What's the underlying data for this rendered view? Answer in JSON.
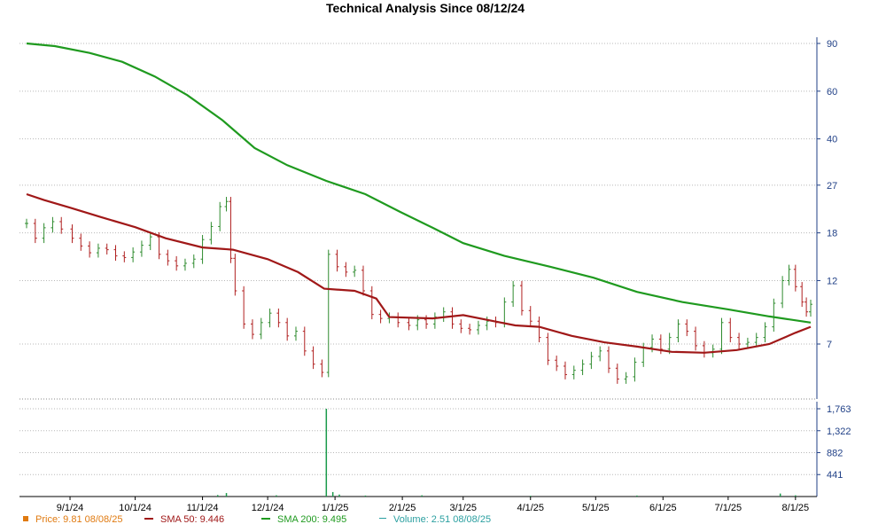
{
  "title": "Technical Analysis Since 08/12/24",
  "colors": {
    "price_up": "#2e8b2e",
    "price_down": "#b02020",
    "sma50": "#a01818",
    "sma200": "#1f9a1f",
    "volume": "#1a9a4a",
    "axis_text": "#1f3f86",
    "grid": "#b8b8b8",
    "legend_price": "#e07a10",
    "legend_sma50": "#a01818",
    "legend_sma200": "#1f9a1f",
    "legend_volume": "#2a9fa0"
  },
  "legend": {
    "price": "Price: 9.81  08/08/25",
    "sma50": "SMA 50: 9.446",
    "sma200": "SMA 200: 9.495",
    "volume": "Volume: 2.51  08/08/25"
  },
  "chart_data": {
    "type": "line",
    "title": "Technical Analysis Since 08/12/24",
    "x_tick_labels": [
      "9/1/24",
      "10/1/24",
      "11/1/24",
      "12/1/24",
      "1/1/25",
      "2/1/25",
      "3/1/25",
      "4/1/25",
      "5/1/25",
      "6/1/25",
      "7/1/25",
      "8/1/25"
    ],
    "x_tick_dates": [
      "2024-09-01",
      "2024-10-01",
      "2024-11-01",
      "2024-12-01",
      "2025-01-01",
      "2025-02-01",
      "2025-03-01",
      "2025-04-01",
      "2025-05-01",
      "2025-06-01",
      "2025-07-01",
      "2025-08-01"
    ],
    "x_range": [
      "2024-08-12",
      "2025-08-08"
    ],
    "y_scale": "log",
    "y_ticks": [
      7,
      12,
      18,
      27,
      40,
      60,
      90
    ],
    "y_ticks_labels": [
      "7",
      "12",
      "18",
      "27",
      "40",
      "60",
      "90"
    ],
    "volume_ticks": [
      441,
      882,
      1322,
      1763
    ],
    "volume_ticks_labels": [
      "441",
      "882",
      "1,322",
      "1,763"
    ],
    "grid": true,
    "series": [
      {
        "name": "Price",
        "style": "ohlc",
        "points": [
          [
            "2024-08-12",
            19.5
          ],
          [
            "2024-08-16",
            17.2
          ],
          [
            "2024-08-20",
            18.8
          ],
          [
            "2024-08-24",
            19.8
          ],
          [
            "2024-08-28",
            18.6
          ],
          [
            "2024-09-02",
            17.2
          ],
          [
            "2024-09-06",
            16.1
          ],
          [
            "2024-09-10",
            15.2
          ],
          [
            "2024-09-14",
            15.8
          ],
          [
            "2024-09-18",
            15.6
          ],
          [
            "2024-09-22",
            14.8
          ],
          [
            "2024-09-26",
            14.6
          ],
          [
            "2024-09-30",
            15.3
          ],
          [
            "2024-10-04",
            16.2
          ],
          [
            "2024-10-08",
            17.4
          ],
          [
            "2024-10-12",
            15.0
          ],
          [
            "2024-10-16",
            14.2
          ],
          [
            "2024-10-20",
            13.6
          ],
          [
            "2024-10-24",
            13.9
          ],
          [
            "2024-10-28",
            14.4
          ],
          [
            "2024-11-01",
            17.0
          ],
          [
            "2024-11-05",
            19.0
          ],
          [
            "2024-11-09",
            22.5
          ],
          [
            "2024-11-12",
            23.5
          ],
          [
            "2024-11-14",
            14.5
          ],
          [
            "2024-11-16",
            11.0
          ],
          [
            "2024-11-20",
            8.3
          ],
          [
            "2024-11-24",
            7.6
          ],
          [
            "2024-11-28",
            8.4
          ],
          [
            "2024-12-02",
            9.1
          ],
          [
            "2024-12-06",
            8.4
          ],
          [
            "2024-12-10",
            7.5
          ],
          [
            "2024-12-14",
            7.8
          ],
          [
            "2024-12-18",
            6.6
          ],
          [
            "2024-12-22",
            5.9
          ],
          [
            "2024-12-26",
            5.5
          ],
          [
            "2024-12-29",
            15.0
          ],
          [
            "2025-01-02",
            13.5
          ],
          [
            "2025-01-06",
            12.9
          ],
          [
            "2025-01-10",
            13.1
          ],
          [
            "2025-01-14",
            11.0
          ],
          [
            "2025-01-18",
            9.0
          ],
          [
            "2025-01-22",
            8.7
          ],
          [
            "2025-01-26",
            8.8
          ],
          [
            "2025-01-30",
            8.4
          ],
          [
            "2025-02-04",
            8.2
          ],
          [
            "2025-02-08",
            8.6
          ],
          [
            "2025-02-12",
            8.3
          ],
          [
            "2025-02-16",
            8.8
          ],
          [
            "2025-02-20",
            9.2
          ],
          [
            "2025-02-24",
            8.3
          ],
          [
            "2025-02-28",
            8.0
          ],
          [
            "2025-03-04",
            7.9
          ],
          [
            "2025-03-08",
            8.2
          ],
          [
            "2025-03-12",
            8.5
          ],
          [
            "2025-03-16",
            8.4
          ],
          [
            "2025-03-20",
            10.0
          ],
          [
            "2025-03-24",
            11.5
          ],
          [
            "2025-03-28",
            9.3
          ],
          [
            "2025-04-01",
            8.5
          ],
          [
            "2025-04-05",
            7.4
          ],
          [
            "2025-04-09",
            6.1
          ],
          [
            "2025-04-13",
            5.8
          ],
          [
            "2025-04-17",
            5.4
          ],
          [
            "2025-04-21",
            5.6
          ],
          [
            "2025-04-25",
            5.9
          ],
          [
            "2025-04-29",
            6.3
          ],
          [
            "2025-05-03",
            6.6
          ],
          [
            "2025-05-07",
            5.7
          ],
          [
            "2025-05-11",
            5.2
          ],
          [
            "2025-05-15",
            5.3
          ],
          [
            "2025-05-19",
            6.0
          ],
          [
            "2025-05-23",
            6.8
          ],
          [
            "2025-05-27",
            7.3
          ],
          [
            "2025-05-31",
            6.7
          ],
          [
            "2025-06-04",
            7.4
          ],
          [
            "2025-06-08",
            8.3
          ],
          [
            "2025-06-12",
            7.8
          ],
          [
            "2025-06-16",
            6.9
          ],
          [
            "2025-06-20",
            6.5
          ],
          [
            "2025-06-24",
            6.7
          ],
          [
            "2025-06-28",
            8.4
          ],
          [
            "2025-07-02",
            7.4
          ],
          [
            "2025-07-06",
            7.0
          ],
          [
            "2025-07-10",
            7.1
          ],
          [
            "2025-07-14",
            7.4
          ],
          [
            "2025-07-18",
            8.1
          ],
          [
            "2025-07-22",
            9.9
          ],
          [
            "2025-07-26",
            12.0
          ],
          [
            "2025-07-29",
            13.2
          ],
          [
            "2025-08-01",
            11.4
          ],
          [
            "2025-08-04",
            10.0
          ],
          [
            "2025-08-06",
            9.2
          ],
          [
            "2025-08-08",
            9.81
          ]
        ]
      },
      {
        "name": "SMA 50",
        "style": "line",
        "points": [
          [
            "2024-08-12",
            25.0
          ],
          [
            "2024-08-20",
            23.8
          ],
          [
            "2024-09-01",
            22.3
          ],
          [
            "2024-09-15",
            20.6
          ],
          [
            "2024-10-01",
            18.9
          ],
          [
            "2024-10-15",
            17.2
          ],
          [
            "2024-11-01",
            15.9
          ],
          [
            "2024-11-15",
            15.6
          ],
          [
            "2024-12-01",
            14.4
          ],
          [
            "2024-12-15",
            12.9
          ],
          [
            "2024-12-27",
            11.2
          ],
          [
            "2025-01-10",
            11.0
          ],
          [
            "2025-01-20",
            10.3
          ],
          [
            "2025-01-26",
            8.8
          ],
          [
            "2025-02-15",
            8.7
          ],
          [
            "2025-03-01",
            8.95
          ],
          [
            "2025-03-15",
            8.5
          ],
          [
            "2025-03-25",
            8.2
          ],
          [
            "2025-04-05",
            8.1
          ],
          [
            "2025-04-20",
            7.5
          ],
          [
            "2025-05-05",
            7.1
          ],
          [
            "2025-05-20",
            6.85
          ],
          [
            "2025-06-05",
            6.55
          ],
          [
            "2025-06-20",
            6.5
          ],
          [
            "2025-07-05",
            6.65
          ],
          [
            "2025-07-20",
            7.0
          ],
          [
            "2025-08-01",
            7.7
          ],
          [
            "2025-08-08",
            8.1
          ]
        ]
      },
      {
        "name": "SMA 200",
        "style": "line",
        "points": [
          [
            "2024-08-12",
            90.0
          ],
          [
            "2024-08-25",
            88.0
          ],
          [
            "2024-09-10",
            83.0
          ],
          [
            "2024-09-25",
            77.0
          ],
          [
            "2024-10-10",
            68.0
          ],
          [
            "2024-10-25",
            58.0
          ],
          [
            "2024-11-10",
            47.0
          ],
          [
            "2024-11-25",
            37.0
          ],
          [
            "2024-12-10",
            32.0
          ],
          [
            "2024-12-28",
            28.0
          ],
          [
            "2025-01-15",
            25.0
          ],
          [
            "2025-01-31",
            21.5
          ],
          [
            "2025-02-15",
            18.8
          ],
          [
            "2025-03-01",
            16.5
          ],
          [
            "2025-03-20",
            14.8
          ],
          [
            "2025-04-10",
            13.5
          ],
          [
            "2025-04-30",
            12.3
          ],
          [
            "2025-05-20",
            10.9
          ],
          [
            "2025-06-10",
            10.0
          ],
          [
            "2025-07-01",
            9.4
          ],
          [
            "2025-07-20",
            8.85
          ],
          [
            "2025-08-08",
            8.4
          ]
        ]
      },
      {
        "name": "Volume",
        "style": "bar",
        "points": [
          [
            "2024-11-08",
            30
          ],
          [
            "2024-11-12",
            70
          ],
          [
            "2024-12-05",
            25
          ],
          [
            "2024-12-28",
            1763
          ],
          [
            "2024-12-31",
            90
          ],
          [
            "2025-01-03",
            40
          ],
          [
            "2025-01-15",
            20
          ],
          [
            "2025-02-10",
            25
          ],
          [
            "2025-04-01",
            15
          ],
          [
            "2025-05-20",
            20
          ],
          [
            "2025-07-25",
            60
          ],
          [
            "2025-08-01",
            25
          ]
        ]
      }
    ]
  }
}
